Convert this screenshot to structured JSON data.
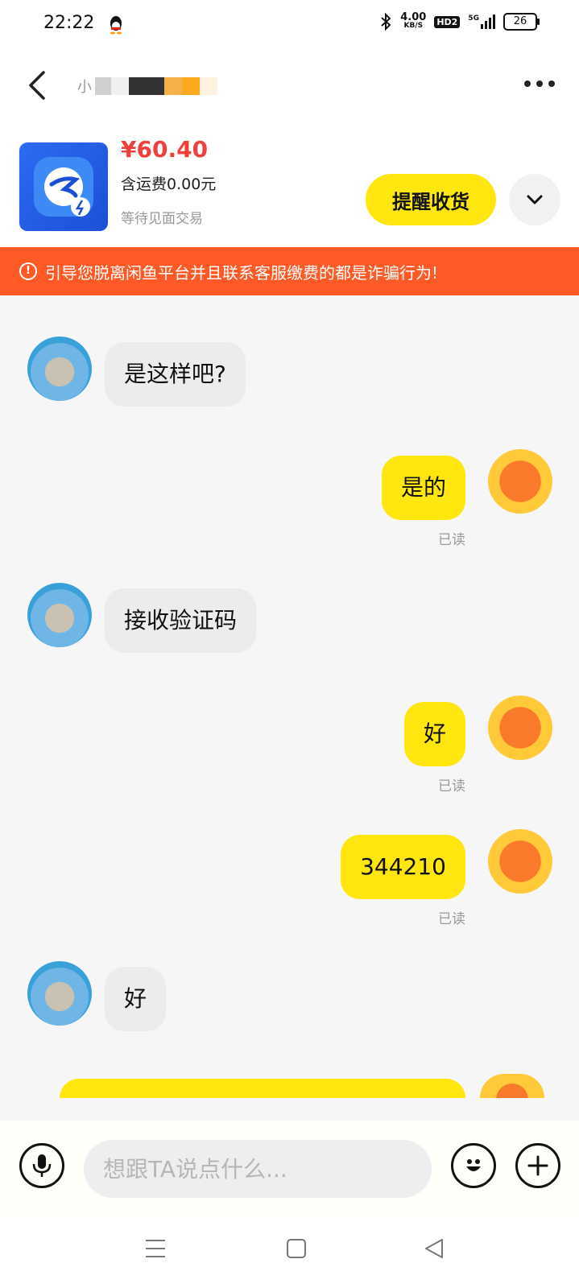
{
  "status_bar": {
    "time": "22:22",
    "net_speed": "4.00",
    "net_unit": "KB/S",
    "hd_label": "HD2",
    "network": "5G",
    "battery": "26"
  },
  "header": {
    "contact_name_visible": "小"
  },
  "product": {
    "price": "¥60.40",
    "shipping": "含运费0.00元",
    "status": "等待见面交易",
    "remind_label": "提醒收货"
  },
  "warning": {
    "text": "引导您脱离闲鱼平台并且联系客服缴费的都是诈骗行为!"
  },
  "messages": [
    {
      "side": "left",
      "text": "是这样吧?"
    },
    {
      "side": "right",
      "text": "是的",
      "status": "已读"
    },
    {
      "side": "left",
      "text": "接收验证码"
    },
    {
      "side": "right",
      "text": "好",
      "status": "已读"
    },
    {
      "side": "right",
      "text": "344210",
      "status": "已读"
    },
    {
      "side": "left",
      "text": "好"
    }
  ],
  "input": {
    "placeholder": "想跟TA说点什么..."
  },
  "colors": {
    "accent_yellow": "#ffe60f",
    "price_red": "#f0403c",
    "warning_orange": "#ff5a26"
  }
}
